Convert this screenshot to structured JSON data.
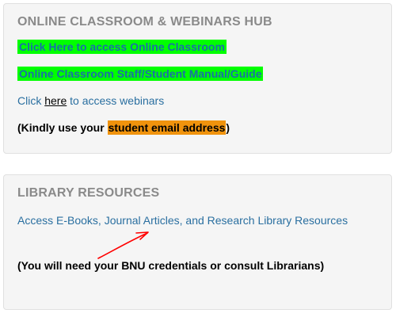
{
  "online_hub": {
    "title": "ONLINE CLASSROOM & WEBINARS HUB",
    "classroom_link": "Click Here to access Online Classroom",
    "manual_link": "Online Classroom Staff/Student Manual/Guide",
    "webinars_prefix": "Click",
    "webinars_link": "here",
    "webinars_suffix": "to access webinars",
    "note_prefix": "(Kindly use your",
    "note_highlight": "student email address",
    "note_suffix": ")"
  },
  "library": {
    "title": "LIBRARY RESOURCES",
    "resources_link": "Access E-Books, Journal Articles, and Research Library Resources",
    "note": "(You will need your BNU credentials or consult Librarians)"
  },
  "colors": {
    "highlight_green": "#00ff00",
    "highlight_orange": "#f0930d",
    "link_blue": "#2a6fa0",
    "annotation_red": "#ff0000"
  }
}
